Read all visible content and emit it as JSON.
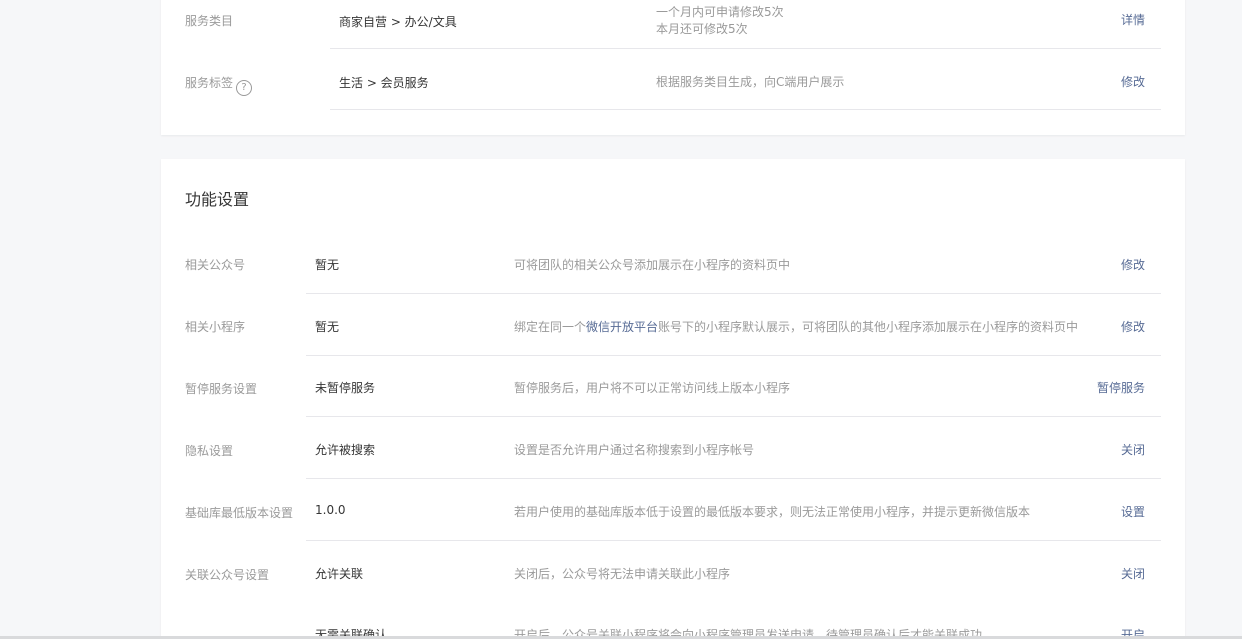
{
  "basic_info": {
    "rows": [
      {
        "label": "服务类目",
        "value": "商家自营 > 办公/文具",
        "desc_line1": "一个月内可申请修改5次",
        "desc_line2": "本月还可修改5次",
        "action": "详情"
      },
      {
        "label": "服务标签",
        "value": "生活 > 会员服务",
        "desc": "根据服务类目生成，向C端用户展示",
        "action": "修改",
        "help_glyph": "?"
      }
    ]
  },
  "function_settings": {
    "title": "功能设置",
    "rows": [
      {
        "label": "相关公众号",
        "value": "暂无",
        "desc": "可将团队的相关公众号添加展示在小程序的资料页中",
        "action": "修改"
      },
      {
        "label": "相关小程序",
        "value": "暂无",
        "desc_prefix": "绑定在同一个",
        "desc_link": "微信开放平台",
        "desc_suffix": "账号下的小程序默认展示，可将团队的其他小程序添加展示在小程序的资料页中",
        "action": "修改"
      },
      {
        "label": "暂停服务设置",
        "value": "未暂停服务",
        "desc": "暂停服务后，用户将不可以正常访问线上版本小程序",
        "action": "暂停服务"
      },
      {
        "label": "隐私设置",
        "value": "允许被搜索",
        "desc": "设置是否允许用户通过名称搜索到小程序帐号",
        "action": "关闭"
      },
      {
        "label": "基础库最低版本设置",
        "value": "1.0.0",
        "desc": "若用户使用的基础库版本低于设置的最低版本要求，则无法正常使用小程序，并提示更新微信版本",
        "action": "设置"
      },
      {
        "label": "关联公众号设置",
        "value": "允许关联",
        "desc": "关闭后，公众号将无法申请关联此小程序",
        "action": "关闭"
      },
      {
        "label": "",
        "value": "无需关联确认",
        "desc": "开启后，公众号关联小程序将会向小程序管理员发送申请，待管理员确认后才能关联成功",
        "action": "开启"
      }
    ]
  },
  "colors": {
    "link": "#576b95",
    "label": "#9a9a9a",
    "text": "#353535",
    "divider": "#e7e7eb",
    "background": "#f6f7f9"
  }
}
